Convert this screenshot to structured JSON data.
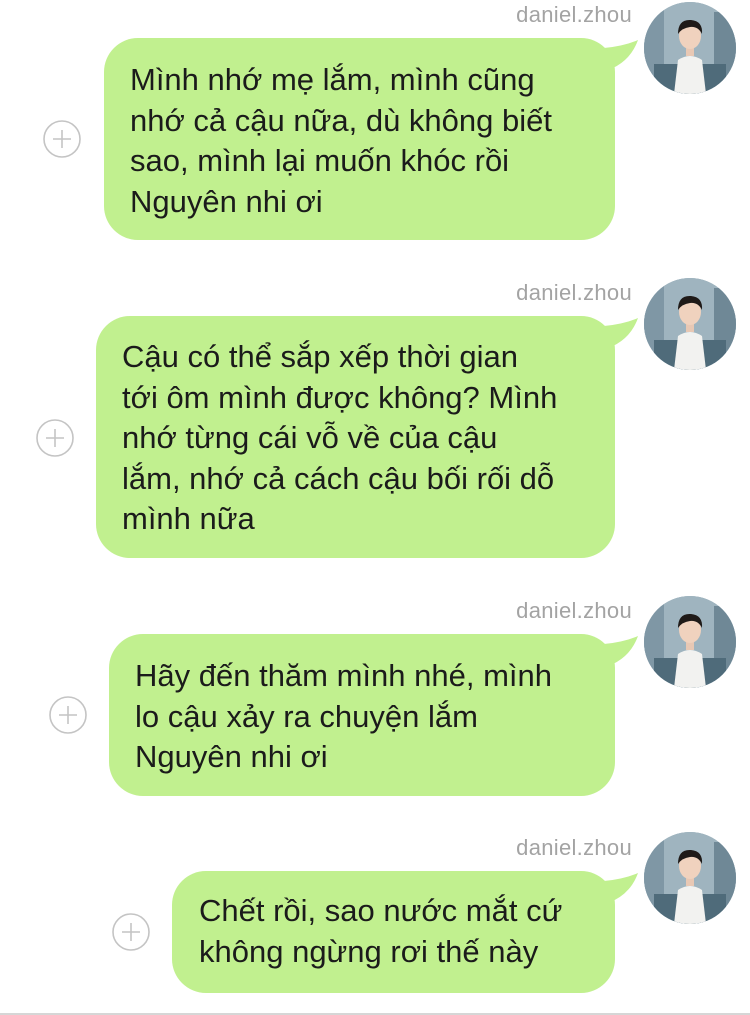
{
  "chat": {
    "bubble_color": "#c1f08f",
    "username_color": "#a3a3a3",
    "messages": [
      {
        "sender": "daniel.zhou",
        "lines": [
          "Mình nhớ mẹ lắm, mình cũng",
          "nhớ cả cậu nữa, dù không biết",
          "sao, mình lại muốn khóc rồi",
          "Nguyên nhi ơi"
        ]
      },
      {
        "sender": "daniel.zhou",
        "lines": [
          "Cậu có thể sắp xếp thời gian",
          "tới ôm mình được không? Mình",
          "nhớ từng cái vỗ về của cậu",
          "lắm, nhớ cả cách cậu bối rối dỗ",
          "mình nữa"
        ]
      },
      {
        "sender": "daniel.zhou",
        "lines": [
          "Hãy đến thăm mình nhé, mình",
          "lo cậu xảy ra chuyện lắm",
          "Nguyên nhi ơi"
        ]
      },
      {
        "sender": "daniel.zhou",
        "lines": [
          "Chết rồi, sao nước mắt cứ",
          "không ngừng rơi thế này"
        ]
      }
    ]
  }
}
